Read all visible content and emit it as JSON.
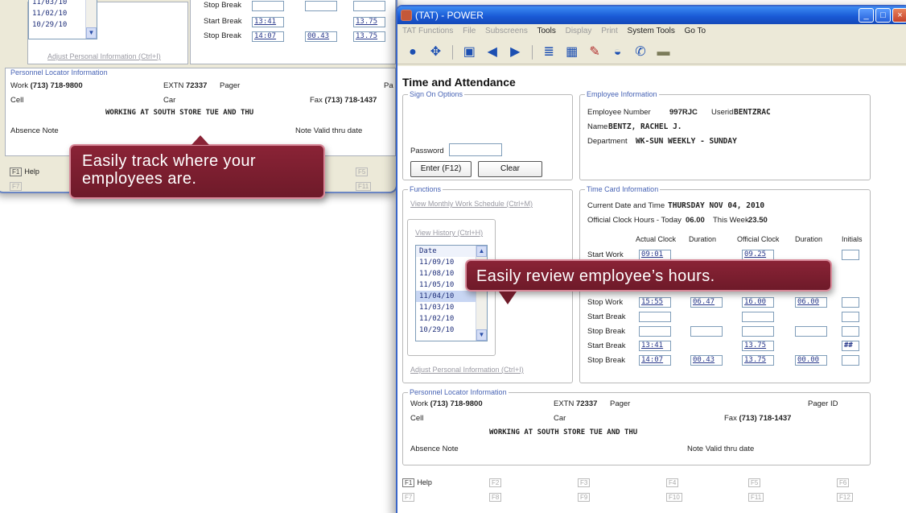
{
  "back_window": {
    "dates": [
      "11/03/10",
      "11/02/10",
      "10/29/10"
    ],
    "adjust_link": "Adjust Personal Information (Ctrl+I)",
    "rows": [
      {
        "label": "Stop Break"
      },
      {
        "label": "Start Break",
        "clock": "13:41",
        "official": "13.75"
      },
      {
        "label": "Stop Break",
        "clock": "14:07",
        "duration": "00.43",
        "official": "13.75"
      }
    ],
    "locator": {
      "legend": "Personnel Locator Information",
      "work_label": "Work",
      "work_value": "(713) 718-9800",
      "extn_label": "EXTN",
      "extn_value": "72337",
      "pager_label": "Pager",
      "pa_label": "Pa",
      "cell_label": "Cell",
      "car_label": "Car",
      "fax_label": "Fax",
      "fax_value": "(713) 718-1437",
      "note": "WORKING AT SOUTH STORE TUE AND THU",
      "absence_label": "Absence Note",
      "valid_label": "Note Valid thru date"
    },
    "fkeys": {
      "help_key": "F1",
      "help_label": "Help",
      "f7": "F7",
      "f5": "F5",
      "f11": "F11"
    }
  },
  "window": {
    "title": "(TAT) - POWER",
    "menu": [
      {
        "label": "TAT Functions",
        "dim": true
      },
      {
        "label": "File",
        "dim": true
      },
      {
        "label": "Subscreens",
        "dim": true
      },
      {
        "label": "Tools",
        "dim": false
      },
      {
        "label": "Display",
        "dim": true
      },
      {
        "label": "Print",
        "dim": true
      },
      {
        "label": "System Tools",
        "dim": false
      },
      {
        "label": "Go To",
        "dim": false
      }
    ],
    "toolbar_icons": [
      "back-circle-icon",
      "navigate-icon",
      "save-icon",
      "previous-icon",
      "next-icon",
      "list-icon",
      "calendar-icon",
      "edit-icon",
      "disc-icon",
      "phone-icon",
      "folder-icon"
    ]
  },
  "page": {
    "title": "Time and Attendance"
  },
  "sign_on": {
    "legend": "Sign On Options",
    "password_label": "Password",
    "password_value": "",
    "enter_label": "Enter (F12)",
    "clear_label": "Clear"
  },
  "employee": {
    "legend": "Employee Information",
    "number_label": "Employee Number",
    "number_value": "997RJC",
    "userid_label": "Userid",
    "userid_value": "BENTZRAC",
    "name_label": "Name",
    "name_value": "BENTZ, RACHEL J.",
    "dept_label": "Department",
    "dept_value": "WK-SUN WEEKLY - SUNDAY"
  },
  "functions": {
    "legend": "Functions",
    "monthly_link": "View Monthly Work Schedule (Ctrl+M)",
    "history_link": "View History (Ctrl+H)",
    "date_header": "Date",
    "dates": [
      "11/09/10",
      "11/08/10",
      "11/05/10",
      "11/04/10",
      "11/03/10",
      "11/02/10",
      "10/29/10"
    ],
    "selected_index": 3,
    "adjust_link": "Adjust Personal Information (Ctrl+I)"
  },
  "time_card": {
    "legend": "Time Card Information",
    "current_label": "Current Date and Time",
    "current_value": "THURSDAY NOV 04, 2010",
    "official_label": "Official Clock Hours - Today",
    "today_value": "06.00",
    "week_label": "This Week",
    "week_value": "23.50",
    "col_actual": "Actual Clock",
    "col_duration": "Duration",
    "col_official": "Official Clock",
    "col_duration2": "Duration",
    "col_initials": "Initials",
    "rows": [
      {
        "label": "Start Work",
        "clock": "09:01",
        "duration": "",
        "official": "09.25",
        "duration2": "",
        "initials": ""
      },
      {
        "label": "Stop Work",
        "clock": "15:55",
        "duration": "06.47",
        "official": "16.00",
        "duration2": "06.00",
        "initials": ""
      },
      {
        "label": "Start Break",
        "clock": "",
        "duration": "",
        "official": "",
        "duration2": "",
        "initials": ""
      },
      {
        "label": "Stop Break",
        "clock": "",
        "duration": "",
        "official": "",
        "duration2": "",
        "initials": ""
      },
      {
        "label": "Start Break",
        "clock": "13:41",
        "duration": "",
        "official": "13.75",
        "duration2": "",
        "initials": "##"
      },
      {
        "label": "Stop Break",
        "clock": "14:07",
        "duration": "00.43",
        "official": "13.75",
        "duration2": "00.00",
        "initials": ""
      }
    ]
  },
  "locator": {
    "legend": "Personnel Locator Information",
    "work_label": "Work",
    "work_value": "(713) 718-9800",
    "extn_label": "EXTN",
    "extn_value": "72337",
    "pager_label": "Pager",
    "pager_id_label": "Pager ID",
    "cell_label": "Cell",
    "car_label": "Car",
    "fax_label": "Fax",
    "fax_value": "(713) 718-1437",
    "note": "WORKING AT SOUTH STORE TUE AND THU",
    "absence_label": "Absence Note",
    "valid_label": "Note Valid thru date"
  },
  "fkeys": [
    {
      "key": "F1",
      "label": "Help",
      "enabled": true
    },
    {
      "key": "F2",
      "label": "",
      "enabled": false
    },
    {
      "key": "F3",
      "label": "",
      "enabled": false
    },
    {
      "key": "F4",
      "label": "",
      "enabled": false
    },
    {
      "key": "F5",
      "label": "",
      "enabled": false
    },
    {
      "key": "F6",
      "label": "",
      "enabled": false
    },
    {
      "key": "F7",
      "label": "",
      "enabled": false
    },
    {
      "key": "F8",
      "label": "",
      "enabled": false
    },
    {
      "key": "F9",
      "label": "",
      "enabled": false
    },
    {
      "key": "F10",
      "label": "",
      "enabled": false
    },
    {
      "key": "F11",
      "label": "",
      "enabled": false
    },
    {
      "key": "F12",
      "label": "",
      "enabled": false
    }
  ],
  "callouts": {
    "track": "Easily track where your employees are.",
    "review": "Easily review employee’s hours."
  }
}
